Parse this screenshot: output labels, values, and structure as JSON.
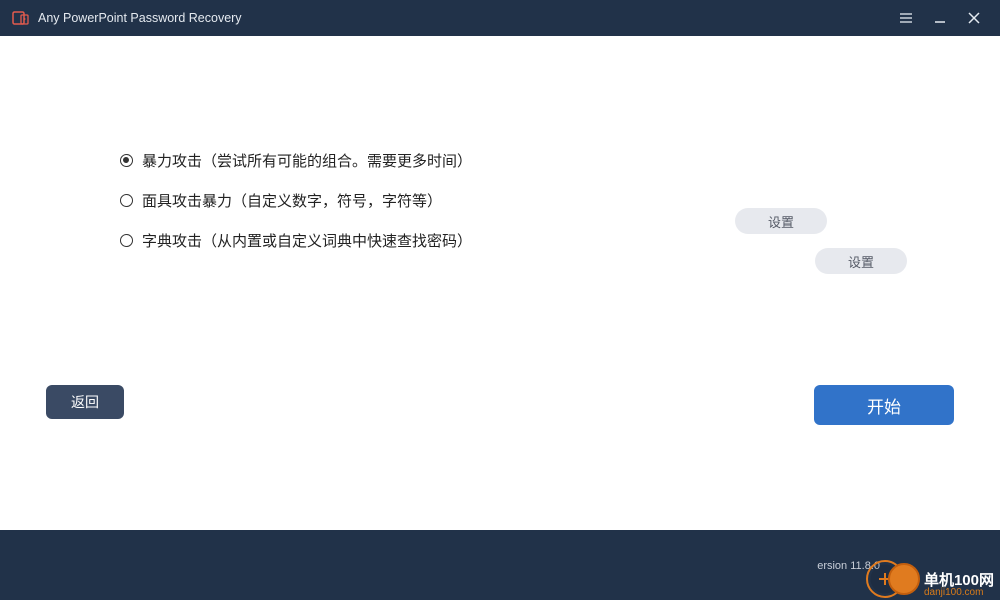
{
  "app": {
    "title": "Any PowerPoint Password Recovery"
  },
  "options": {
    "brute_force": "暴力攻击（尝试所有可能的组合。需要更多时间）",
    "mask": "面具攻击暴力（自定义数字，符号，字符等）",
    "dictionary": "字典攻击（从内置或自定义词典中快速查找密码）",
    "settings_label": "设置"
  },
  "buttons": {
    "back": "返回",
    "start": "开始"
  },
  "footer": {
    "version": "ersion 11.8.0",
    "watermark_cn": "单机100网",
    "watermark_en": "danji100.com"
  }
}
